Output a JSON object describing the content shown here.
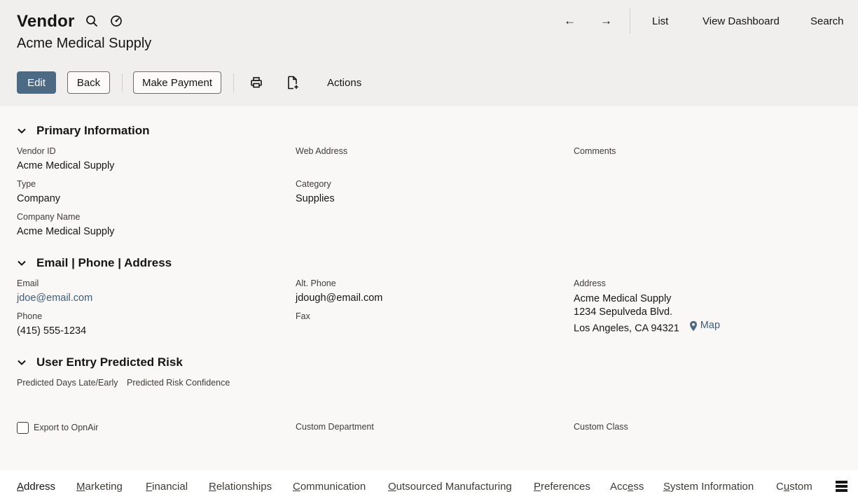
{
  "header": {
    "record_type": "Vendor",
    "record_name": "Acme Medical Supply",
    "nav": {
      "back_arrow": "←",
      "forward_arrow": "→",
      "list": "List",
      "view_dashboard": "View Dashboard",
      "search": "Search"
    }
  },
  "toolbar": {
    "edit": "Edit",
    "back": "Back",
    "make_payment": "Make Payment",
    "actions": "Actions"
  },
  "sections": {
    "primary": {
      "title": "Primary Information",
      "vendor_id_label": "Vendor ID",
      "vendor_id": "Acme Medical Supply",
      "web_address_label": "Web Address",
      "comments_label": "Comments",
      "type_label": "Type",
      "type": "Company",
      "category_label": "Category",
      "category": "Supplies",
      "company_name_label": "Company Name",
      "company_name": "Acme Medical Supply"
    },
    "contact": {
      "title": "Email | Phone | Address",
      "email_label": "Email",
      "email": "jdoe@email.com",
      "alt_phone_label": "Alt. Phone",
      "alt_phone": "jdough@email.com",
      "address_label": "Address",
      "address_line1": "Acme Medical Supply",
      "address_line2": "1234 Sepulveda Blvd.",
      "address_line3": "Los Angeles, CA 94321",
      "map_label": "Map",
      "phone_label": "Phone",
      "phone": "(415) 555-1234",
      "fax_label": "Fax"
    },
    "risk": {
      "title": "User Entry Predicted Risk",
      "days_late_label": "Predicted Days Late/Early",
      "confidence_label": "Predicted Risk Confidence"
    },
    "misc": {
      "export_label": "Export to OpnAir",
      "export_checked": false,
      "custom_department_label": "Custom Department",
      "custom_class_label": "Custom Class"
    }
  },
  "tabs": [
    {
      "first": "A",
      "rest": "ddress"
    },
    {
      "first": "M",
      "rest": "arketing"
    },
    {
      "first": "F",
      "rest": "inancial"
    },
    {
      "first": "R",
      "rest": "elationships"
    },
    {
      "first": "C",
      "rest": "ommunication"
    },
    {
      "first": "O",
      "rest": "utsourced Manufacturing"
    },
    {
      "first": "P",
      "rest": "references"
    },
    {
      "pre": "Acc",
      "first": "e",
      "rest": "ss"
    },
    {
      "first": "S",
      "rest": "ystem Information"
    },
    {
      "pre": "C",
      "first": "u",
      "rest": "stom"
    }
  ],
  "active_tab_index": 0,
  "colors": {
    "primary_button": "#4d6a85",
    "link": "#3d5d7c",
    "header_bg": "#f1efed",
    "page_bg": "#f9f8f6"
  },
  "icons": [
    "search-icon",
    "dashboard-icon",
    "print-icon",
    "new-document-icon",
    "chevron-down-icon",
    "map-pin-icon",
    "tabs-menu-icon"
  ]
}
